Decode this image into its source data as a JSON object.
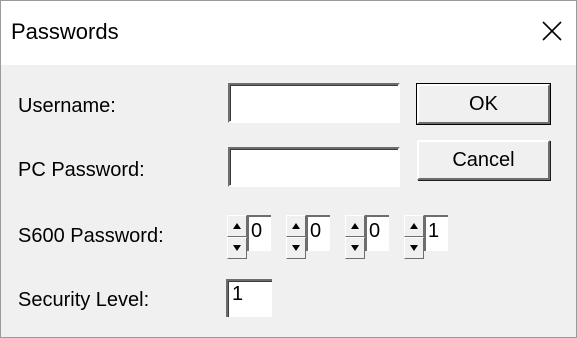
{
  "window": {
    "title": "Passwords",
    "close_icon": "close-icon"
  },
  "fields": {
    "username_label": "Username:",
    "username_value": "",
    "pc_password_label": "PC Password:",
    "pc_password_value": "",
    "s600_password_label": "S600 Password:",
    "s600_digits": [
      "0",
      "0",
      "0",
      "1"
    ],
    "security_level_label": "Security Level:",
    "security_level_value": "1"
  },
  "buttons": {
    "ok_label": "OK",
    "cancel_label": "Cancel"
  },
  "icons": {
    "spin_up": "arrow-up-icon",
    "spin_down": "arrow-down-icon"
  }
}
